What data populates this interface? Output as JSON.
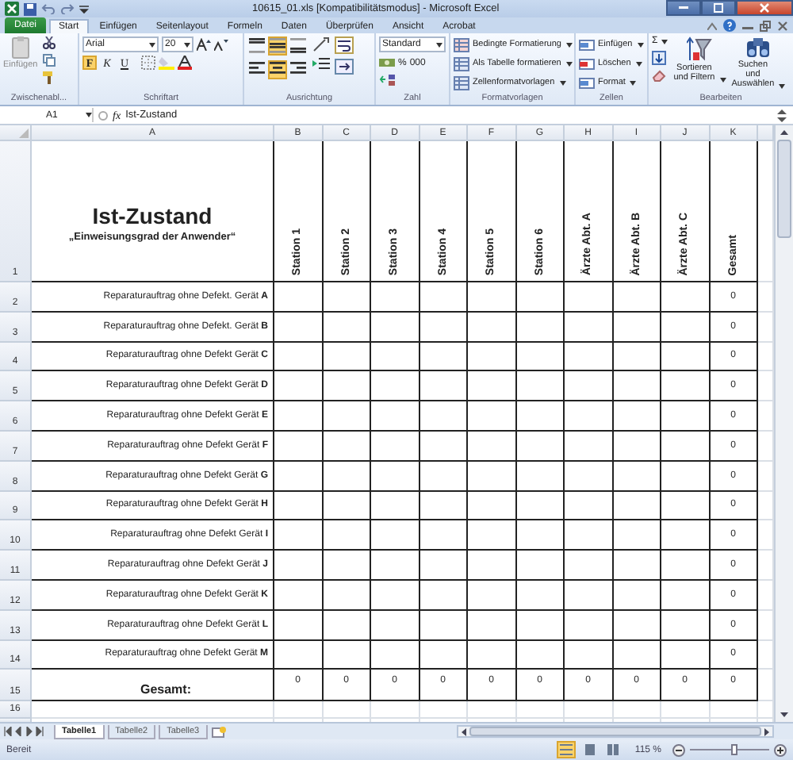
{
  "window": {
    "title": "10615_01.xls  [Kompatibilitätsmodus]  -  Microsoft Excel"
  },
  "ribbon_tabs": [
    {
      "label": "Datei",
      "kind": "file",
      "selected": false
    },
    {
      "label": "Start",
      "kind": "tab",
      "selected": true
    },
    {
      "label": "Einfügen",
      "kind": "tab",
      "selected": false
    },
    {
      "label": "Seitenlayout",
      "kind": "tab",
      "selected": false
    },
    {
      "label": "Formeln",
      "kind": "tab",
      "selected": false
    },
    {
      "label": "Daten",
      "kind": "tab",
      "selected": false
    },
    {
      "label": "Überprüfen",
      "kind": "tab",
      "selected": false
    },
    {
      "label": "Ansicht",
      "kind": "tab",
      "selected": false
    },
    {
      "label": "Acrobat",
      "kind": "tab",
      "selected": false
    }
  ],
  "ribbon": {
    "clipboard": {
      "label": "Zwischenabl...",
      "paste_button": "Einfügen"
    },
    "font": {
      "label": "Schriftart",
      "font_name": "Arial",
      "font_size": "20",
      "styles": [
        {
          "label": "F",
          "selected": true
        },
        {
          "label": "K",
          "selected": false
        },
        {
          "label": "U",
          "selected": false
        }
      ]
    },
    "alignment": {
      "label": "Ausrichtung",
      "buttons": [
        {
          "kind": "top",
          "selected": false
        },
        {
          "kind": "middle",
          "selected": true
        },
        {
          "kind": "bottom",
          "selected": false
        },
        {
          "kind": "left",
          "selected": false
        },
        {
          "kind": "center",
          "selected": true
        },
        {
          "kind": "right",
          "selected": false
        }
      ]
    },
    "number": {
      "label": "Zahl",
      "format": "Standard",
      "percent": "%",
      "thousands": "000"
    },
    "styles": {
      "label": "Formatvorlagen",
      "items": [
        "Bedingte Formatierung",
        "Als Tabelle formatieren",
        "Zellenformatvorlagen"
      ]
    },
    "cells": {
      "label": "Zellen",
      "items": [
        "Einfügen",
        "Löschen",
        "Format"
      ]
    },
    "editing": {
      "label": "Bearbeiten",
      "sum": "Σ",
      "sort": "Sortieren und Filtern",
      "find": "Suchen und Auswählen"
    }
  },
  "formula_bar": {
    "name_box": "A1",
    "function_label": "fx",
    "value": "Ist-Zustand"
  },
  "sheet": {
    "columns": [
      "A",
      "B",
      "C",
      "D",
      "E",
      "F",
      "G",
      "H",
      "I",
      "J",
      "K"
    ],
    "title": "Ist-Zustand",
    "subtitle": "„Einweisungsgrad der Anwender“",
    "headers": [
      "Station 1",
      "Station 2",
      "Station 3",
      "Station 4",
      "Station 5",
      "Station 6",
      "Ärzte Abt. A",
      "Ärzte Abt. B",
      "Ärzte Abt. C",
      "Gesamt"
    ],
    "rows": [
      {
        "number": "2",
        "label": "Reparaturauftrag ohne Defekt. Gerät **A**",
        "total": "0"
      },
      {
        "number": "3",
        "label": "Reparaturauftrag ohne Defekt. Gerät **B**",
        "total": "0"
      },
      {
        "number": "4",
        "label": "Reparaturauftrag ohne Defekt Gerät **C**",
        "total": "0"
      },
      {
        "number": "5",
        "label": "Reparaturauftrag ohne Defekt Gerät **D**",
        "total": "0"
      },
      {
        "number": "6",
        "label": "Reparaturauftrag ohne Defekt Gerät **E**",
        "total": "0"
      },
      {
        "number": "7",
        "label": "Reparaturauftrag ohne Defekt Gerät **F**",
        "total": "0"
      },
      {
        "number": "8",
        "label": "Reparaturauftrag ohne Defekt Gerät **G**",
        "total": "0"
      },
      {
        "number": "9",
        "label": "Reparaturauftrag ohne Defekt Gerät **H**",
        "total": "0"
      },
      {
        "number": "10",
        "label": "Reparaturauftrag ohne Defekt Gerät **I**",
        "total": "0"
      },
      {
        "number": "11",
        "label": "Reparaturauftrag ohne Defekt Gerät **J**",
        "total": "0"
      },
      {
        "number": "12",
        "label": "Reparaturauftrag ohne Defekt Gerät **K**",
        "total": "0"
      },
      {
        "number": "13",
        "label": "Reparaturauftrag ohne Defekt Gerät **L**",
        "total": "0"
      },
      {
        "number": "14",
        "label": "Reparaturauftrag ohne Defekt Gerät **M**",
        "total": "0"
      }
    ],
    "total_row": {
      "number": "15",
      "label": "Gesamt:",
      "values": [
        "0",
        "0",
        "0",
        "0",
        "0",
        "0",
        "0",
        "0",
        "0",
        "0"
      ]
    },
    "first_row_number": "1",
    "empty_row_number": "16"
  },
  "sheet_tabs": [
    {
      "label": "Tabelle1",
      "selected": true
    },
    {
      "label": "Tabelle2",
      "selected": false
    },
    {
      "label": "Tabelle3",
      "selected": false
    }
  ],
  "status_bar": {
    "text": "Bereit",
    "views": [
      {
        "kind": "normal",
        "selected": true
      },
      {
        "kind": "page_layout",
        "selected": false
      },
      {
        "kind": "page_break",
        "selected": false
      }
    ],
    "zoom": "115 %",
    "zoom_slider": {
      "level": 0.55
    }
  }
}
